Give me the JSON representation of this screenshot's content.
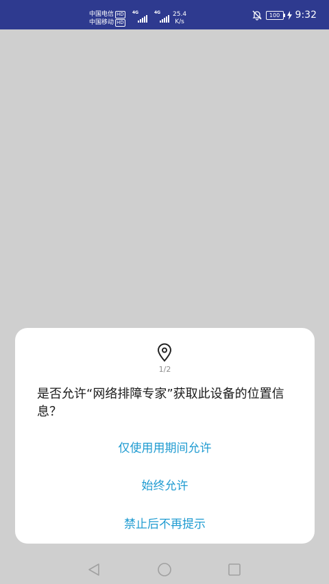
{
  "status_bar": {
    "carrier_1": "中国电信",
    "carrier_2": "中国移动",
    "hd_label": "HD",
    "network_gen": "4G",
    "speed_value": "25.4",
    "speed_unit": "K/s",
    "battery": "100",
    "time": "9:32",
    "icons": [
      "signal-icon",
      "bell-off-icon",
      "battery-icon",
      "charging-bolt-icon"
    ]
  },
  "dialog": {
    "icon": "location-pin-icon",
    "page_indicator": "1/2",
    "prompt": "是否允许“网络排障专家”获取此设备的位置信息？",
    "options": {
      "while_using": "仅使用用期间允许",
      "always": "始终允许",
      "deny": "禁止后不再提示"
    },
    "accent_color": "#1f9bd1"
  },
  "nav_bar": {
    "icons": [
      "back-icon",
      "home-icon",
      "recents-icon"
    ]
  },
  "colors": {
    "status_bar_bg": "#2e3a8f",
    "screen_dim": "#cfcfcf",
    "dialog_bg": "#ffffff"
  }
}
